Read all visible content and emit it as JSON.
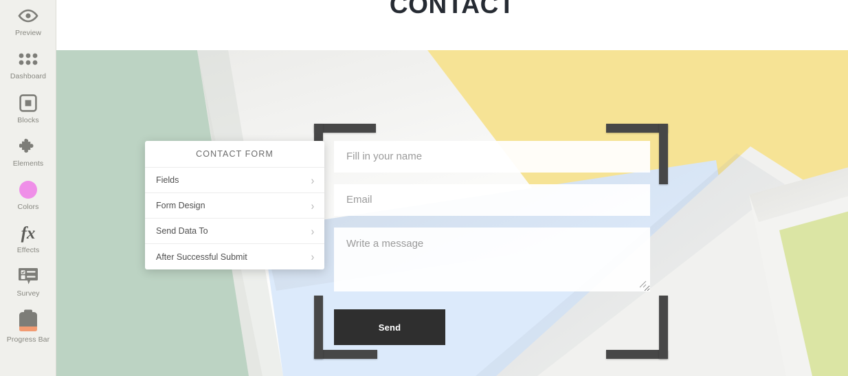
{
  "sidebar": {
    "items": [
      {
        "label": "Preview",
        "icon": "eye-icon",
        "name": "preview"
      },
      {
        "label": "Dashboard",
        "icon": "grid-dots-icon",
        "name": "dashboard"
      },
      {
        "label": "Blocks",
        "icon": "blocks-square-icon",
        "name": "blocks"
      },
      {
        "label": "Elements",
        "icon": "puzzle-piece-icon",
        "name": "elements"
      },
      {
        "label": "Colors",
        "icon": "color-circle-icon",
        "name": "colors"
      },
      {
        "label": "Effects",
        "icon": "fx-icon",
        "name": "effects"
      },
      {
        "label": "Survey",
        "icon": "survey-bubble-icon",
        "name": "survey"
      },
      {
        "label": "Progress Bar",
        "icon": "progress-bar-icon",
        "name": "progress-bar"
      }
    ]
  },
  "header": {
    "title": "CONTACT"
  },
  "context_menu": {
    "title": "CONTACT FORM",
    "items": [
      {
        "label": "Fields"
      },
      {
        "label": "Form Design"
      },
      {
        "label": "Send Data To"
      },
      {
        "label": "After Successful Submit"
      }
    ],
    "chevron": "›"
  },
  "form": {
    "name_placeholder": "Fill in your name",
    "name_value": "",
    "email_placeholder": "Email",
    "email_value": "",
    "message_placeholder": "Write a message",
    "message_value": "",
    "submit_label": "Send"
  },
  "colors": {
    "sidebar_bg": "#f0f0ec",
    "icon_gray": "#7d7d78",
    "colors_swatch": "#ef8fe8",
    "progress_accent": "#f29b72",
    "canvas_gray": "#f2f2ef",
    "shape_sage_green": "#bcd3c3",
    "shape_yellow": "#f6e395",
    "shape_light_blue": "#dceafb",
    "shape_white_card": "#f1f1ef",
    "shape_lime_card": "#dbe5a4",
    "bracket_dark": "#474747",
    "button_dark": "#2f2f2f",
    "title_dark": "#262b33"
  }
}
